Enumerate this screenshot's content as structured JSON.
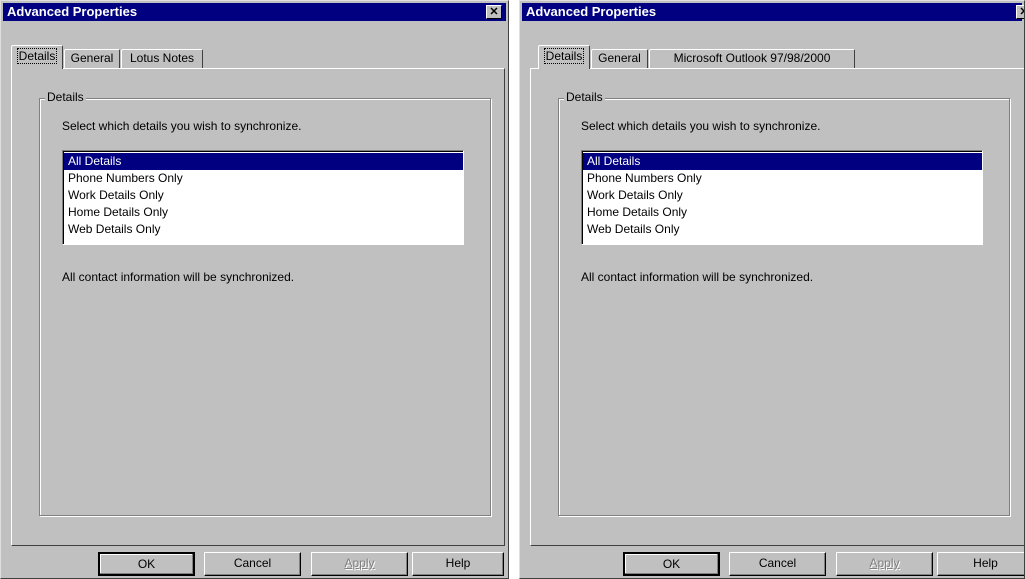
{
  "dialogs": [
    {
      "title": "Advanced Properties",
      "close_label": "✕",
      "tabs": [
        "Details",
        "General",
        "Lotus Notes"
      ],
      "group_label": "Details",
      "prompt": "Select which details you wish to synchronize.",
      "list_items": [
        "All Details",
        "Phone Numbers Only",
        "Work Details Only",
        "Home Details Only",
        "Web Details Only"
      ],
      "selected_item": "All Details",
      "status": "All contact information will be synchronized.",
      "buttons": {
        "ok": "OK",
        "cancel": "Cancel",
        "apply": "Apply",
        "help": "Help"
      }
    },
    {
      "title": "Advanced Properties",
      "close_label": "✕",
      "tabs": [
        "Details",
        "General",
        "Microsoft Outlook 97/98/2000"
      ],
      "group_label": "Details",
      "prompt": "Select which details you wish to synchronize.",
      "list_items": [
        "All Details",
        "Phone Numbers Only",
        "Work Details Only",
        "Home Details Only",
        "Web Details Only"
      ],
      "selected_item": "All Details",
      "status": "All contact information will be synchronized.",
      "buttons": {
        "ok": "OK",
        "cancel": "Cancel",
        "apply": "Apply",
        "help": "Help"
      }
    }
  ],
  "colors": {
    "titlebar": "#000080",
    "dialog_bg": "#c0c0c0",
    "selection": "#000080"
  }
}
